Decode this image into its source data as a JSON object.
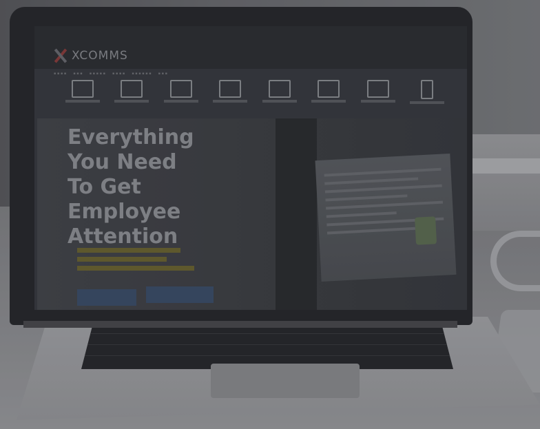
{
  "logo": {
    "text": "XCOMMS"
  },
  "hero": {
    "title_lines": [
      "Everything",
      "You Need",
      "To Get",
      "Employee",
      "Attention"
    ]
  },
  "colors": {
    "lid": "#2a2b2f",
    "screen": "#3a3c42",
    "hero_text": "#8f9197",
    "accent_red": "#8a3f3f",
    "accent_yellow": "#6b6534",
    "button_blue": "#3d4f6a"
  }
}
